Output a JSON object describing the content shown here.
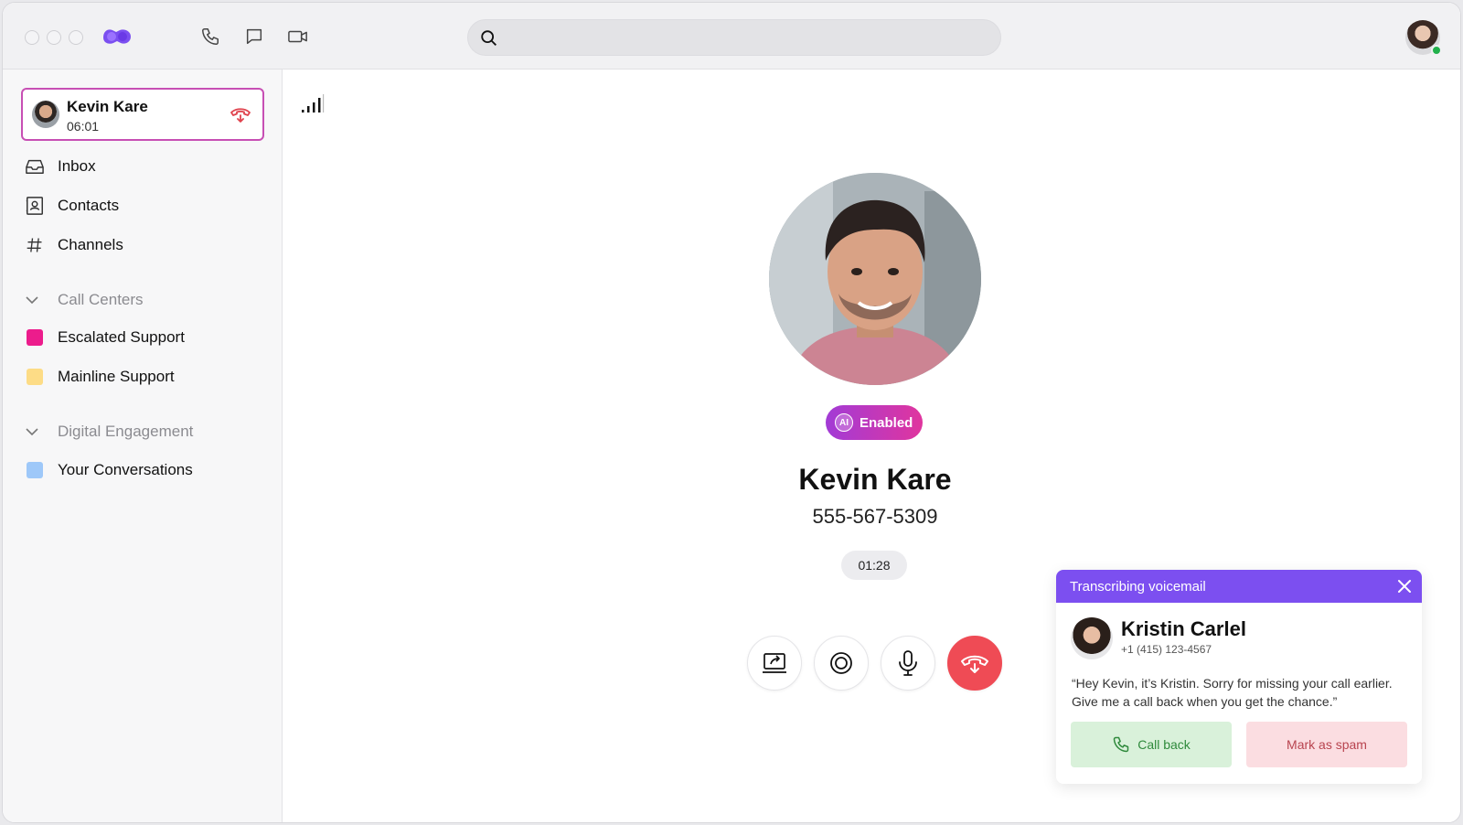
{
  "active_call": {
    "name": "Kevin Kare",
    "duration": "06:01"
  },
  "search": {
    "placeholder": ""
  },
  "nav": [
    {
      "label": "Inbox",
      "icon": "inbox-icon"
    },
    {
      "label": "Contacts",
      "icon": "contacts-icon"
    },
    {
      "label": "Channels",
      "icon": "hash-icon"
    }
  ],
  "sections": {
    "call_centers": {
      "label": "Call Centers",
      "items": [
        {
          "label": "Escalated Support",
          "color": "#ec1c8c"
        },
        {
          "label": "Mainline Support",
          "color": "#fddc86"
        }
      ]
    },
    "digital_engagement": {
      "label": "Digital Engagement",
      "items": [
        {
          "label": "Your Conversations",
          "color": "#9ec8f9"
        }
      ]
    }
  },
  "call": {
    "badge": "Enabled",
    "badge_icon": "AI",
    "name": "Kevin Kare",
    "phone": "555-567-5309",
    "timer": "01:28",
    "controls": [
      "share-screen-icon",
      "record-icon",
      "microphone-icon",
      "hangup-icon"
    ]
  },
  "voicemail": {
    "header": "Transcribing voicemail",
    "name": "Kristin Carlel",
    "phone": "+1 (415) 123-4567",
    "transcript": "“Hey Kevin, it’s Kristin. Sorry for missing your call earlier. Give me a call back when you get the chance.”",
    "call_back_label": "Call back",
    "spam_label": "Mark as spam"
  },
  "colors": {
    "accent": "#7c4ff0",
    "hangup": "#ef4b55",
    "online": "#22b14c"
  }
}
